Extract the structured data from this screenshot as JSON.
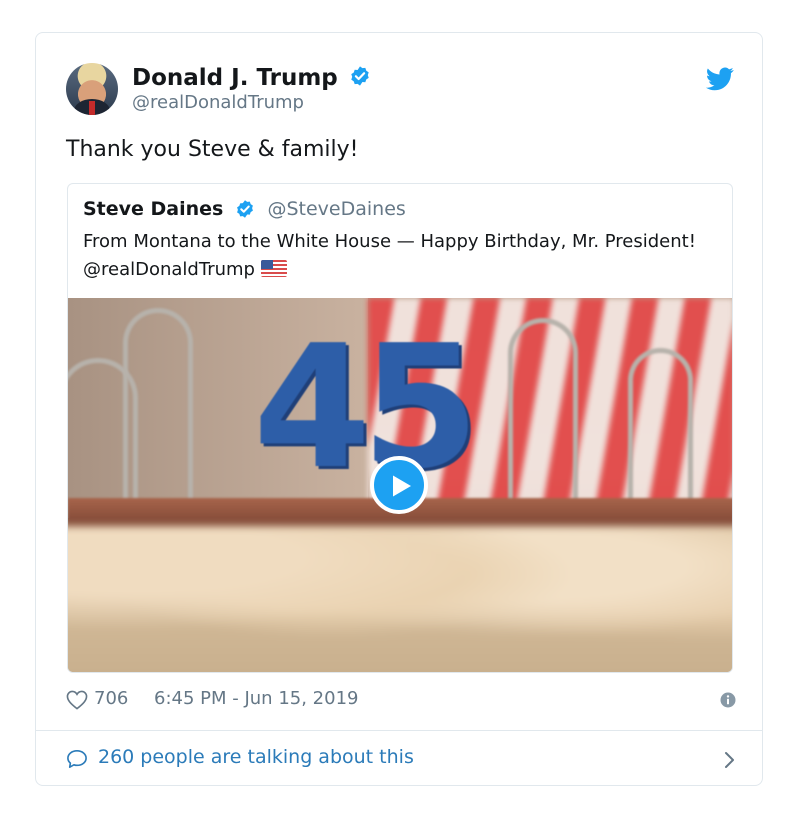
{
  "author": {
    "display_name": "Donald J. Trump",
    "handle": "@realDonaldTrump",
    "verified": true
  },
  "tweet": {
    "text": "Thank you Steve & family!"
  },
  "quoted_tweet": {
    "display_name": "Steve Daines",
    "handle": "@SteveDaines",
    "verified": true,
    "text": "From Montana to the White House — Happy Birthday, Mr. President! @realDonaldTrump",
    "flag_icon": "us-flag-emoji",
    "media": {
      "type": "video",
      "candle_digits": "45"
    }
  },
  "meta": {
    "like_count": "706",
    "timestamp": "6:45 PM - Jun 15, 2019"
  },
  "footer": {
    "talking_text": "260 people are talking about this"
  },
  "colors": {
    "twitter_blue": "#1da1f2",
    "link_blue": "#2b7bb9",
    "muted_gray": "#657786",
    "border": "#e1e8ed"
  },
  "icons": [
    "twitter-bird-icon",
    "verified-badge-icon",
    "heart-icon",
    "info-icon",
    "comment-bubble-icon",
    "chevron-right-icon",
    "play-icon"
  ]
}
